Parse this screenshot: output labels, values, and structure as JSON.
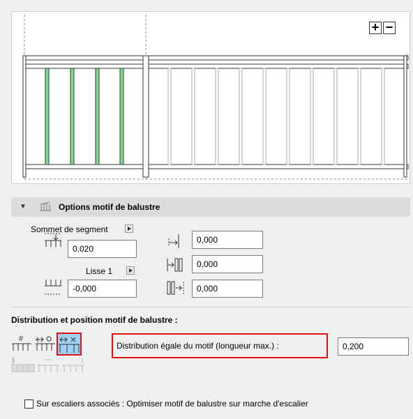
{
  "preview": {
    "zoom_in_label": "+",
    "zoom_out_label": "−"
  },
  "section": {
    "title": "Options motif de balustre",
    "icon": "baluster-pattern-icon"
  },
  "segment": {
    "top_label": "Sommet de segment",
    "top_value": "0,020",
    "rail_label": "Lisse 1",
    "rail_value": "-0,000",
    "offset_left_value": "0,000",
    "offset_span_value": "0,000",
    "offset_right_value": "0,000"
  },
  "distribution": {
    "heading": "Distribution et position motif de balustre :",
    "mode_label": "Distribution égale du motif (longueur max.) :",
    "mode_value": "0,200",
    "options": [
      "fixed-count-icon",
      "fixed-length-icon",
      "equal-distribution-icon"
    ],
    "selected_option": "equal-distribution-icon",
    "alignment_options": [
      "align-start-icon",
      "align-center-icon",
      "align-end-icon"
    ]
  },
  "stairs": {
    "checkbox_label": "Sur escaliers associés : Optimiser motif de balustre sur marche d'escalier",
    "checked": false
  },
  "colors": {
    "highlight_green": "#7ddc8a",
    "selection_red": "#e01010",
    "selected_blue": "#9fd0f5"
  }
}
